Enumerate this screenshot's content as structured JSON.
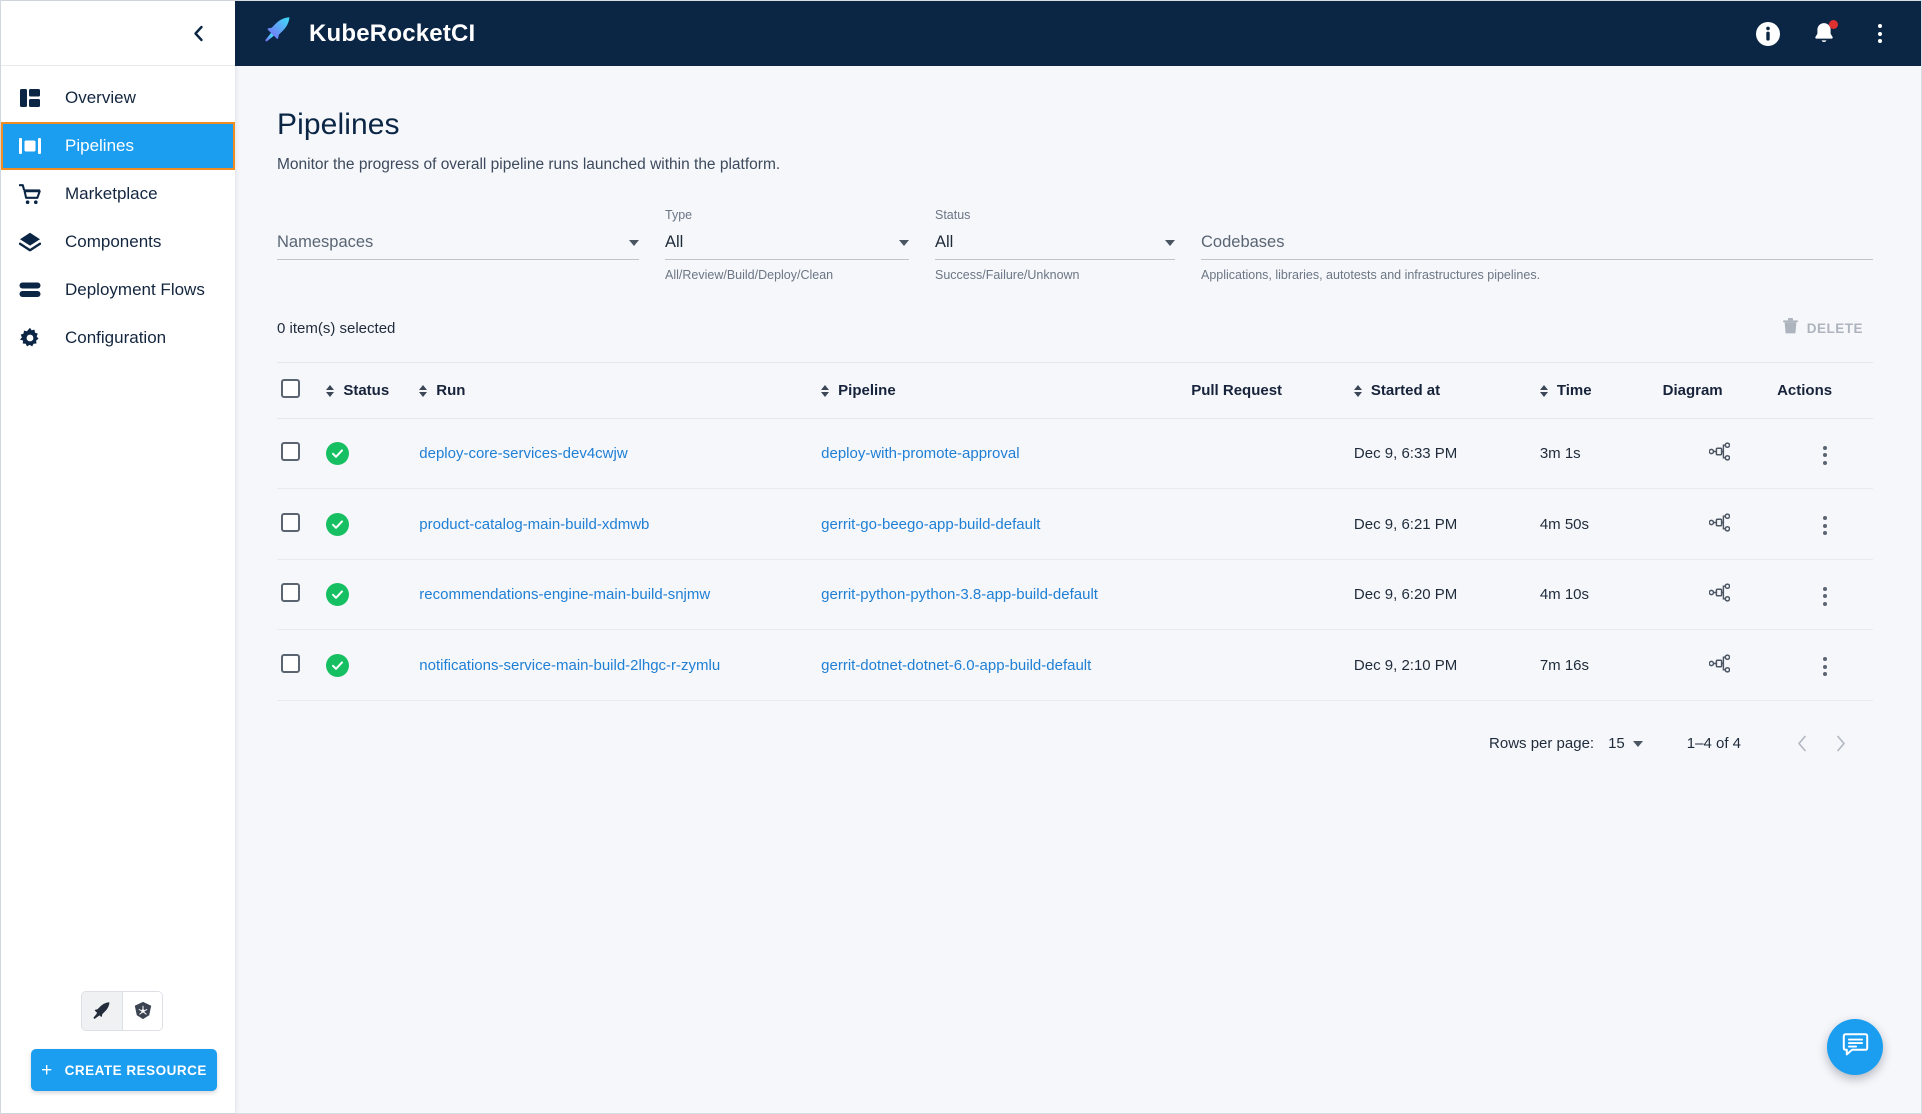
{
  "topbar": {
    "brand": "KubeRocketCI",
    "logo_icon": "rocket-icon",
    "info_icon": "info-icon",
    "notifications_icon": "bell-icon",
    "menu_icon": "kebab-menu-icon",
    "has_notification_badge": true,
    "background": "#0b2545"
  },
  "sidebar": {
    "collapse_icon": "chevron-left-icon",
    "active_index": 1,
    "active_color": "#1b9df0",
    "active_border_color": "#f08c24",
    "items": [
      {
        "label": "Overview",
        "icon": "dashboard-icon"
      },
      {
        "label": "Pipelines",
        "icon": "pipelines-icon"
      },
      {
        "label": "Marketplace",
        "icon": "cart-icon"
      },
      {
        "label": "Components",
        "icon": "layers-icon"
      },
      {
        "label": "Deployment Flows",
        "icon": "stack-icon"
      },
      {
        "label": "Configuration",
        "icon": "gear-icon"
      }
    ],
    "toggles": [
      {
        "icon": "rocket-icon",
        "selected": true
      },
      {
        "icon": "kubernetes-icon",
        "selected": false
      }
    ],
    "create_button": {
      "label": "CREATE RESOURCE",
      "plus": "+"
    }
  },
  "page": {
    "title": "Pipelines",
    "subtitle": "Monitor the progress of overall pipeline runs launched within the platform."
  },
  "filters": {
    "namespaces": {
      "label": "",
      "value": "Namespaces",
      "help": "",
      "is_placeholder": true
    },
    "type": {
      "label": "Type",
      "value": "All",
      "help": "All/Review/Build/Deploy/Clean",
      "is_placeholder": false
    },
    "status": {
      "label": "Status",
      "value": "All",
      "help": "Success/Failure/Unknown",
      "is_placeholder": false
    },
    "codebases": {
      "label": "",
      "value": "Codebases",
      "help": "Applications, libraries, autotests and infrastructures pipelines.",
      "is_placeholder": true
    }
  },
  "toolbar": {
    "selected_text": "0 item(s) selected",
    "delete_label": "DELETE",
    "delete_icon": "trash-icon",
    "delete_disabled": true
  },
  "table": {
    "columns": [
      {
        "key": "checkbox",
        "label": "",
        "sortable": false
      },
      {
        "key": "status",
        "label": "Status",
        "sortable": true
      },
      {
        "key": "run",
        "label": "Run",
        "sortable": true
      },
      {
        "key": "pipeline",
        "label": "Pipeline",
        "sortable": true
      },
      {
        "key": "pull_request",
        "label": "Pull Request",
        "sortable": false
      },
      {
        "key": "started_at",
        "label": "Started at",
        "sortable": true
      },
      {
        "key": "time",
        "label": "Time",
        "sortable": true
      },
      {
        "key": "diagram",
        "label": "Diagram",
        "sortable": false
      },
      {
        "key": "actions",
        "label": "Actions",
        "sortable": false
      }
    ],
    "rows": [
      {
        "selected": false,
        "status": "success",
        "status_icon": "check-circle-icon",
        "run": "deploy-core-services-dev4cwjw",
        "pipeline": "deploy-with-promote-approval",
        "pull_request": "",
        "started_at": "Dec 9, 6:33 PM",
        "time": "3m 1s",
        "diagram_icon": "hierarchy-icon",
        "actions_icon": "kebab-menu-icon"
      },
      {
        "selected": false,
        "status": "success",
        "status_icon": "check-circle-icon",
        "run": "product-catalog-main-build-xdmwb",
        "pipeline": "gerrit-go-beego-app-build-default",
        "pull_request": "",
        "started_at": "Dec 9, 6:21 PM",
        "time": "4m 50s",
        "diagram_icon": "hierarchy-icon",
        "actions_icon": "kebab-menu-icon"
      },
      {
        "selected": false,
        "status": "success",
        "status_icon": "check-circle-icon",
        "run": "recommendations-engine-main-build-snjmw",
        "pipeline": "gerrit-python-python-3.8-app-build-default",
        "pull_request": "",
        "started_at": "Dec 9, 6:20 PM",
        "time": "4m 10s",
        "diagram_icon": "hierarchy-icon",
        "actions_icon": "kebab-menu-icon"
      },
      {
        "selected": false,
        "status": "success",
        "status_icon": "check-circle-icon",
        "run": "notifications-service-main-build-2lhgc-r-zymlu",
        "pipeline": "gerrit-dotnet-dotnet-6.0-app-build-default",
        "pull_request": "",
        "started_at": "Dec 9, 2:10 PM",
        "time": "7m 16s",
        "diagram_icon": "hierarchy-icon",
        "actions_icon": "kebab-menu-icon"
      }
    ]
  },
  "pagination": {
    "rows_per_page_label": "Rows per page:",
    "rows_per_page_value": "15",
    "range_label": "1–4 of 4",
    "prev_icon": "chevron-left-icon",
    "next_icon": "chevron-right-icon"
  },
  "fab": {
    "icon": "chat-icon",
    "color": "#1b9df0"
  }
}
